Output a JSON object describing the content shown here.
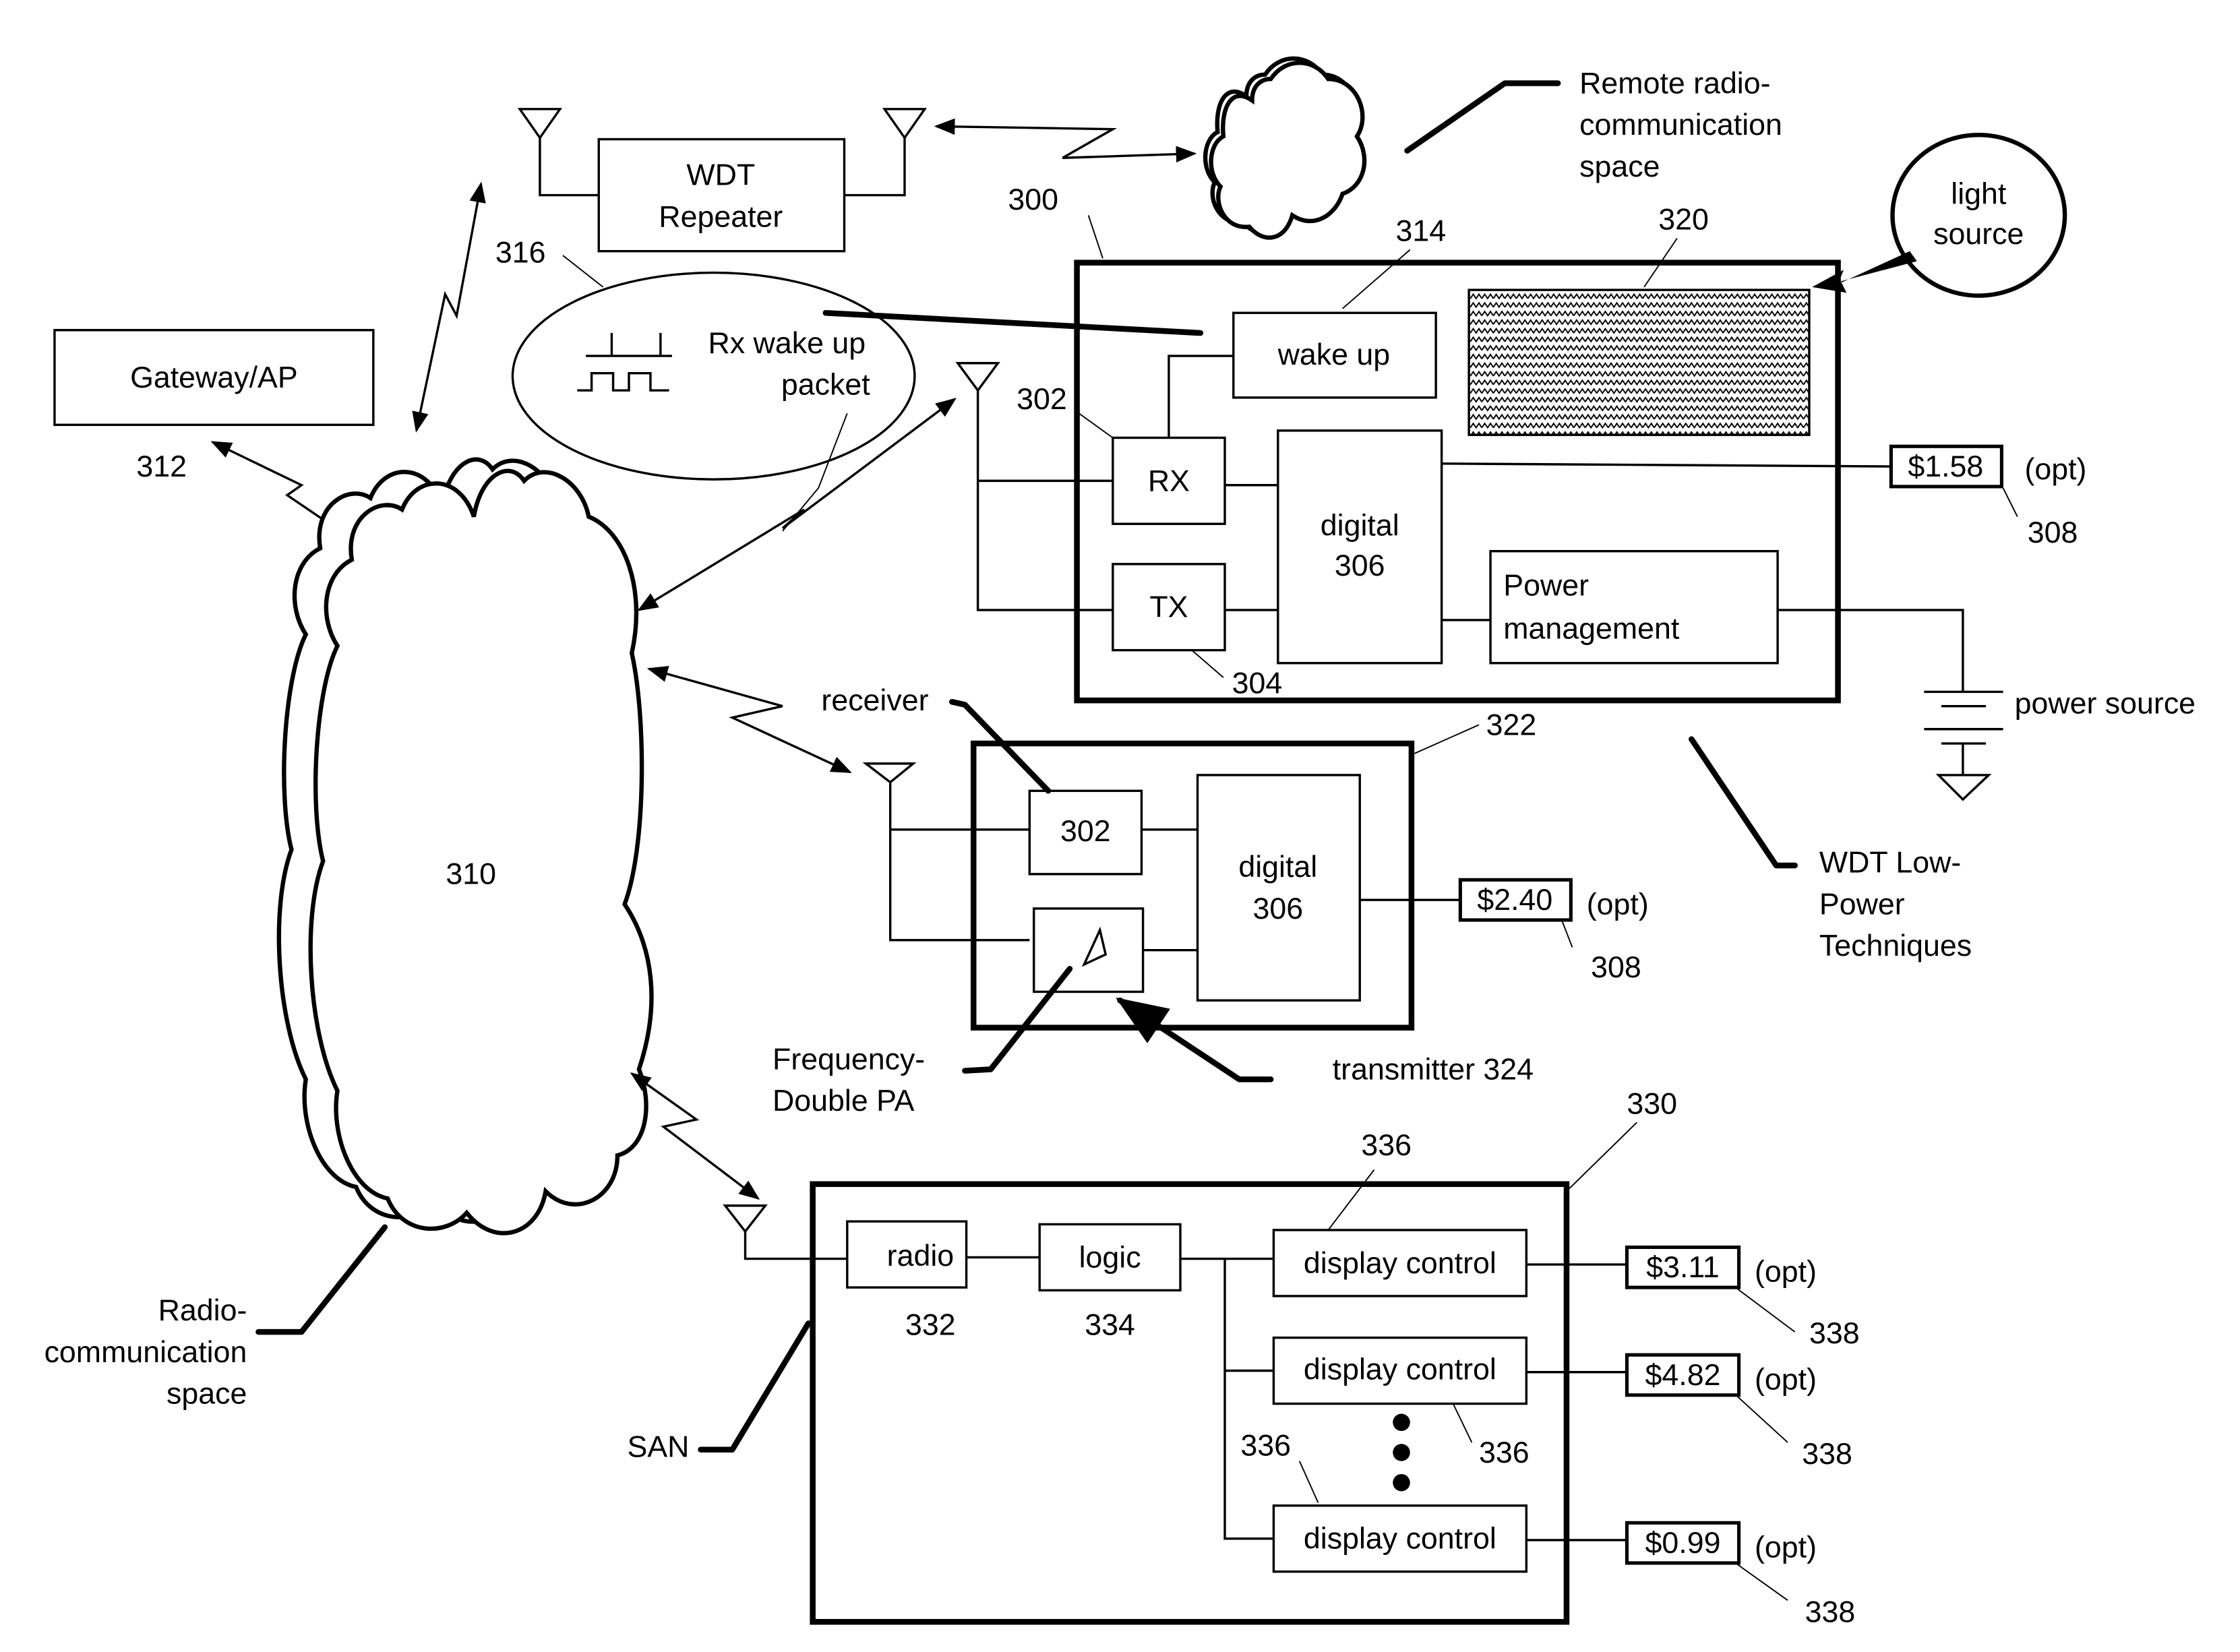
{
  "figure": {
    "remote_space_label": [
      "Remote radio-",
      "communication",
      "space"
    ],
    "light_source_label": [
      "light",
      "source"
    ],
    "wdt_repeater_label": [
      "WDT",
      "Repeater"
    ],
    "gateway_label": "Gateway/AP",
    "gateway_ref": "312",
    "packet_ref": "316",
    "packet_label": [
      "Rx wake up",
      "packet"
    ],
    "cloud_ref": "310",
    "radio_space_label": [
      "Radio-",
      "communication",
      "space"
    ],
    "device_300": {
      "ref": "300",
      "wake_up_label": "wake up",
      "wake_up_ref": "314",
      "display_ref": "320",
      "rx_label": "RX",
      "rx_ref": "302",
      "tx_label": "TX",
      "tx_ref": "304",
      "digital_label": [
        "digital",
        "306"
      ],
      "power_mgmt_label": [
        "Power",
        "management"
      ],
      "price": "$1.58",
      "price_opt": "(opt)",
      "price_ref": "308",
      "power_source_label": "power source",
      "techniques_label": [
        "WDT Low-",
        "Power",
        "Techniques"
      ]
    },
    "device_322": {
      "ref": "322",
      "receiver_label": "receiver",
      "receiver_box": "302",
      "digital_label": [
        "digital",
        "306"
      ],
      "price": "$2.40",
      "price_opt": "(opt)",
      "price_ref": "308",
      "pa_label": [
        "Frequency-",
        "Double PA"
      ],
      "transmitter_label": "transmitter 324"
    },
    "device_330": {
      "ref": "330",
      "san_label": "SAN",
      "radio_label": "radio",
      "radio_ref": "332",
      "logic_label": "logic",
      "logic_ref": "334",
      "display_controls": [
        {
          "label": "display control",
          "ref": "336",
          "price": "$3.11",
          "opt": "(opt)",
          "price_ref": "338"
        },
        {
          "label": "display control",
          "ref": "336",
          "price": "$4.82",
          "opt": "(opt)",
          "price_ref": "338"
        },
        {
          "label": "display control",
          "ref": "336",
          "price": "$0.99",
          "opt": "(opt)",
          "price_ref": "338"
        }
      ]
    }
  }
}
